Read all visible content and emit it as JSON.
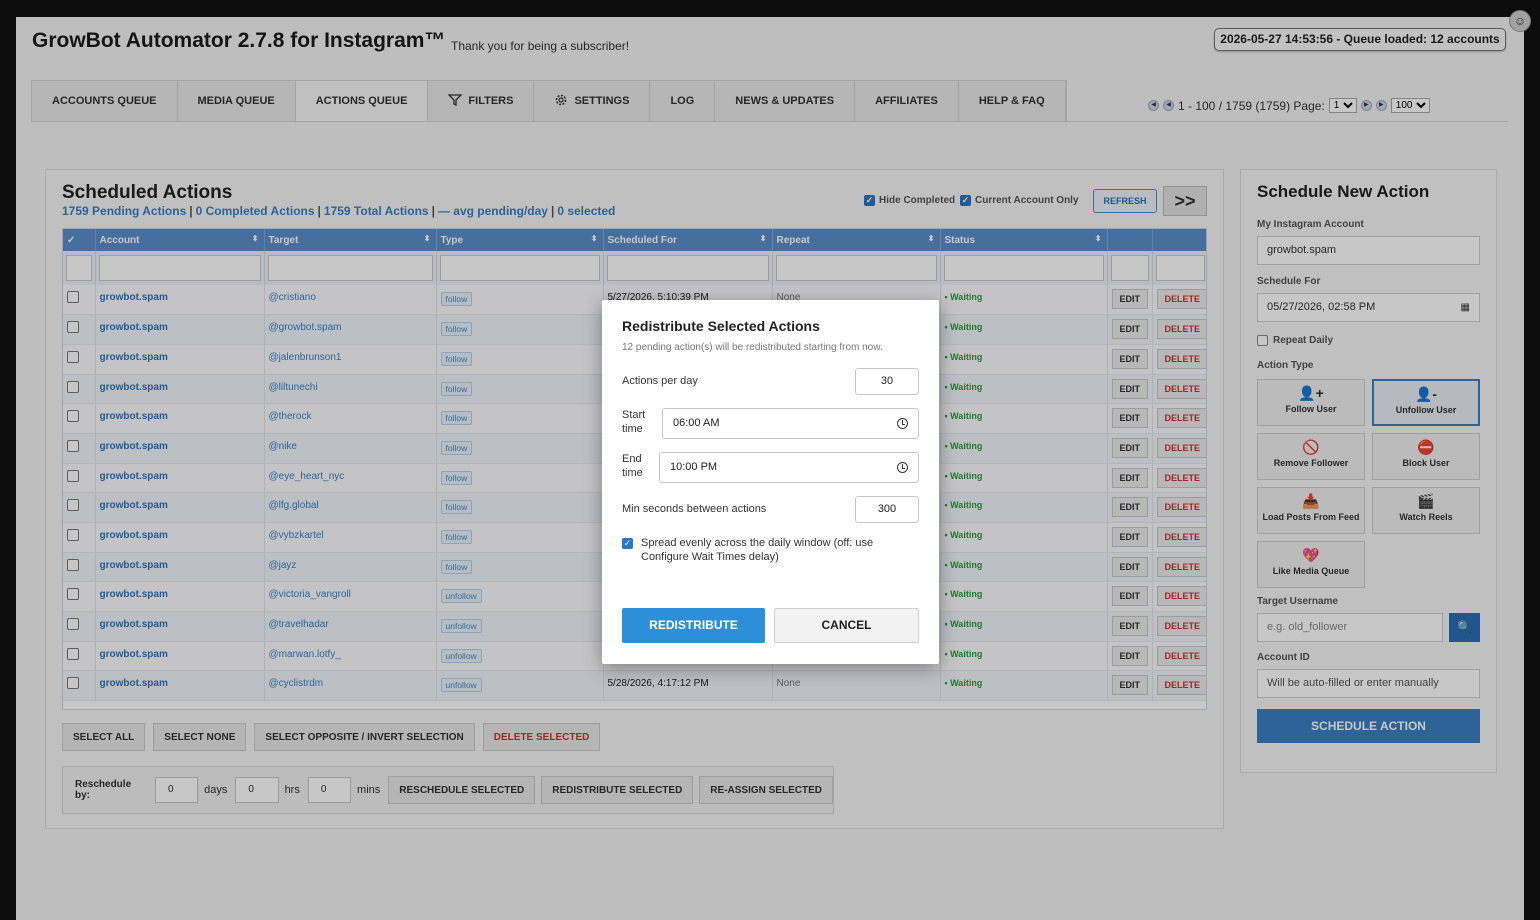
{
  "app": {
    "title": "GrowBot Automator 2.7.8 for Instagram™",
    "subtitle": "Thank you for being a subscriber!",
    "status": "2026-05-27 14:53:56 - Queue loaded: 12 accounts"
  },
  "tabs": [
    {
      "label": "ACCOUNTS QUEUE"
    },
    {
      "label": "MEDIA QUEUE"
    },
    {
      "label": "ACTIONS QUEUE",
      "active": true
    },
    {
      "label": "FILTERS",
      "icon": "funnel-icon"
    },
    {
      "label": "SETTINGS",
      "icon": "gear-icon"
    },
    {
      "label": "LOG"
    },
    {
      "label": "NEWS & UPDATES"
    },
    {
      "label": "AFFILIATES"
    },
    {
      "label": "HELP & FAQ"
    }
  ],
  "pager": {
    "range": "1 - 100 / 1759 (1759) Page:",
    "page": "1",
    "page_size": "100"
  },
  "scheduled": {
    "title": "Scheduled Actions",
    "stats": {
      "pending": "1759 Pending Actions",
      "completed": "0 Completed Actions",
      "total": "1759 Total Actions",
      "avg": "— avg pending/day",
      "selected": "0 selected",
      "sep": "|"
    },
    "hide_completed": "Hide Completed",
    "current_account_only": "Current Account Only",
    "refresh": "REFRESH",
    "expand": ">>",
    "columns": {
      "check": "✓",
      "account": "Account",
      "target": "Target",
      "type": "Type",
      "scheduled_for": "Scheduled For",
      "repeat": "Repeat",
      "status": "Status"
    },
    "edit_label": "EDIT",
    "delete_label": "DELETE",
    "rows": [
      {
        "account": "growbot.spam",
        "target": "@cristiano",
        "type": "follow",
        "scheduled": "5/27/2026, 5:10:39 PM",
        "repeat": "None",
        "status": "• Waiting"
      },
      {
        "account": "growbot.spam",
        "target": "@growbot.spam",
        "type": "follow",
        "scheduled": "",
        "repeat": "",
        "status": "• Waiting"
      },
      {
        "account": "growbot.spam",
        "target": "@jalenbrunson1",
        "type": "follow",
        "scheduled": "",
        "repeat": "",
        "status": "• Waiting"
      },
      {
        "account": "growbot.spam",
        "target": "@liltunechi",
        "type": "follow",
        "scheduled": "",
        "repeat": "",
        "status": "• Waiting"
      },
      {
        "account": "growbot.spam",
        "target": "@therock",
        "type": "follow",
        "scheduled": "",
        "repeat": "",
        "status": "• Waiting"
      },
      {
        "account": "growbot.spam",
        "target": "@nike",
        "type": "follow",
        "scheduled": "",
        "repeat": "",
        "status": "• Waiting"
      },
      {
        "account": "growbot.spam",
        "target": "@eye_heart_nyc",
        "type": "follow",
        "scheduled": "",
        "repeat": "",
        "status": "• Waiting"
      },
      {
        "account": "growbot.spam",
        "target": "@lfg.global",
        "type": "follow",
        "scheduled": "",
        "repeat": "",
        "status": "• Waiting"
      },
      {
        "account": "growbot.spam",
        "target": "@vybzkartel",
        "type": "follow",
        "scheduled": "",
        "repeat": "",
        "status": "• Waiting"
      },
      {
        "account": "growbot.spam",
        "target": "@jayz",
        "type": "follow",
        "scheduled": "",
        "repeat": "",
        "status": "• Waiting"
      },
      {
        "account": "growbot.spam",
        "target": "@victoria_vangroll",
        "type": "unfollow",
        "scheduled": "",
        "repeat": "",
        "status": "• Waiting"
      },
      {
        "account": "growbot.spam",
        "target": "@travelhadar",
        "type": "unfollow",
        "scheduled": "",
        "repeat": "",
        "status": "• Waiting"
      },
      {
        "account": "growbot.spam",
        "target": "@marwan.lotfy_",
        "type": "unfollow",
        "scheduled": "",
        "repeat": "",
        "status": "• Waiting"
      },
      {
        "account": "growbot.spam",
        "target": "@cyclistrdm",
        "type": "unfollow",
        "scheduled": "5/28/2026, 4:17:12 PM",
        "repeat": "None",
        "status": "• Waiting"
      }
    ],
    "bulk": {
      "select_all": "SELECT ALL",
      "select_none": "SELECT NONE",
      "invert": "SELECT OPPOSITE / INVERT SELECTION",
      "delete_selected": "DELETE SELECTED"
    },
    "reschedule": {
      "label": "Reschedule by:",
      "days_value": "0",
      "days": "days",
      "hrs_value": "0",
      "hrs": "hrs",
      "mins_value": "0",
      "mins": "mins",
      "reschedule_btn": "RESCHEDULE SELECTED",
      "redistribute_btn": "REDISTRIBUTE SELECTED",
      "reassign_btn": "RE-ASSIGN SELECTED"
    }
  },
  "new_action": {
    "title": "Schedule New Action",
    "account_label": "My Instagram Account",
    "account_value": "growbot.spam",
    "schedule_label": "Schedule For",
    "schedule_value": "05/27/2026, 02:58 PM",
    "repeat_label": "Repeat Daily",
    "action_type_label": "Action Type",
    "actions": [
      {
        "label": "Follow User",
        "icon": "👤+",
        "name": "follow-user"
      },
      {
        "label": "Unfollow User",
        "icon": "👤-",
        "name": "unfollow-user",
        "selected": true
      },
      {
        "label": "Remove Follower",
        "icon": "🚫",
        "name": "remove-follower"
      },
      {
        "label": "Block User",
        "icon": "⛔",
        "name": "block-user"
      },
      {
        "label": "Load Posts From Feed",
        "icon": "📥",
        "name": "load-posts"
      },
      {
        "label": "Watch Reels",
        "icon": "🎬",
        "name": "watch-reels"
      },
      {
        "label": "Like Media Queue",
        "icon": "💖",
        "name": "like-media"
      }
    ],
    "target_label": "Target Username",
    "target_placeholder": "e.g. old_follower",
    "account_id_label": "Account ID",
    "account_id_placeholder": "Will be auto-filled or enter manually",
    "schedule_btn": "SCHEDULE ACTION"
  },
  "modal": {
    "title": "Redistribute Selected Actions",
    "subtitle": "12 pending action(s) will be redistributed starting from now.",
    "per_day_label": "Actions per day",
    "per_day_value": "30",
    "start_label": "Start time",
    "start_value": "06:00 AM",
    "end_label": "End time",
    "end_value": "10:00 PM",
    "min_seconds_label": "Min seconds between actions",
    "min_seconds_value": "300",
    "spread_label": "Spread evenly across the daily window (off: use Configure Wait Times delay)",
    "primary": "REDISTRIBUTE",
    "cancel": "CANCEL"
  }
}
